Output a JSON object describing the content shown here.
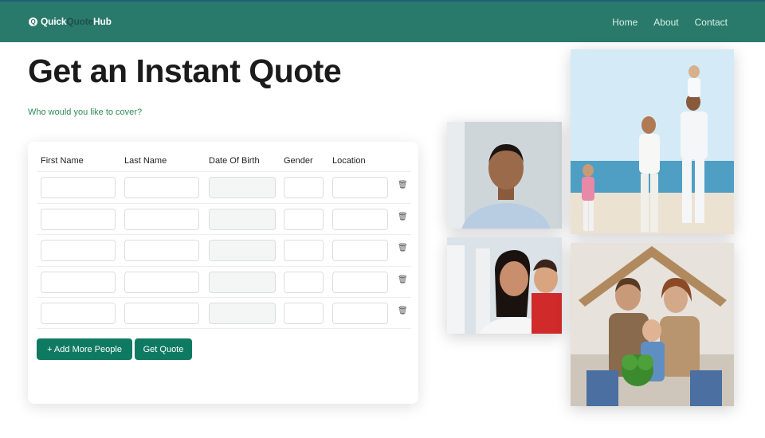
{
  "brand": {
    "part1": "Quick",
    "part2": "Quote",
    "part3": "Hub",
    "mark": "Q"
  },
  "nav": {
    "items": [
      "Home",
      "About",
      "Contact"
    ]
  },
  "page": {
    "title": "Get an Instant Quote",
    "subtitle": "Who would you like to cover?"
  },
  "form": {
    "columns": [
      "First Name",
      "Last Name",
      "Date Of Birth",
      "Gender",
      "Location"
    ],
    "rows": [
      {
        "first_name": "",
        "last_name": "",
        "dob": "",
        "gender": "",
        "location": ""
      },
      {
        "first_name": "",
        "last_name": "",
        "dob": "",
        "gender": "",
        "location": ""
      },
      {
        "first_name": "",
        "last_name": "",
        "dob": "",
        "gender": "",
        "location": ""
      },
      {
        "first_name": "",
        "last_name": "",
        "dob": "",
        "gender": "",
        "location": ""
      },
      {
        "first_name": "",
        "last_name": "",
        "dob": "",
        "gender": "",
        "location": ""
      }
    ],
    "add_button": "+ Add More People",
    "submit_button": "Get Quote"
  },
  "colors": {
    "accent": "#2a7a6b",
    "button": "#0f7a62",
    "subtitle": "#2e8b57"
  },
  "icons": {
    "delete": "trash-icon"
  }
}
